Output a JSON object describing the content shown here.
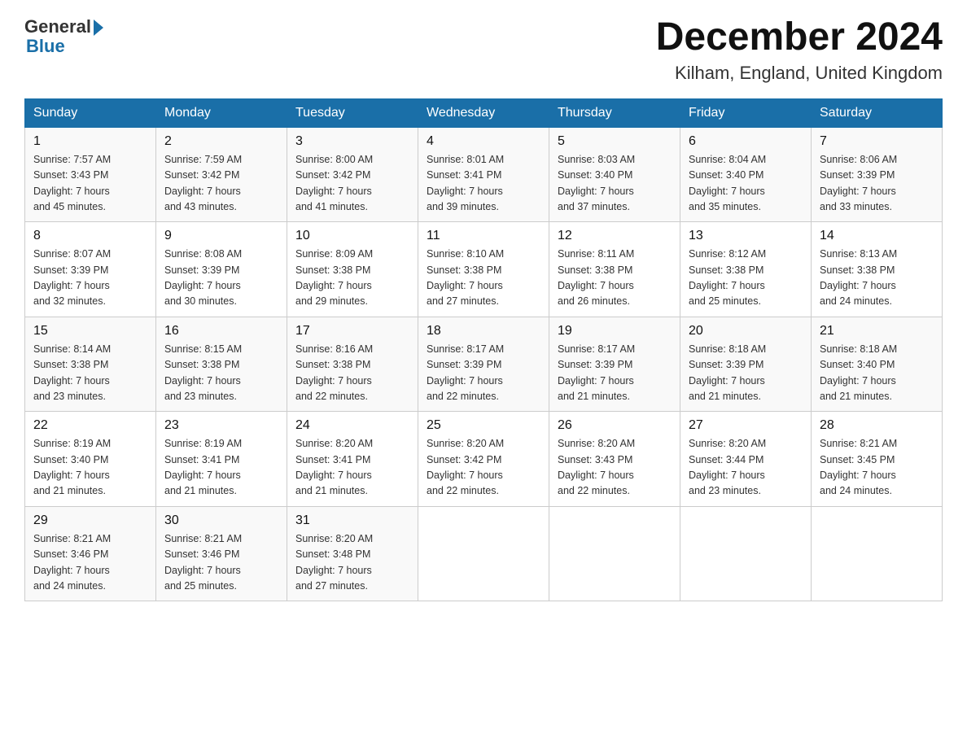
{
  "logo": {
    "general": "General",
    "blue": "Blue"
  },
  "title": "December 2024",
  "subtitle": "Kilham, England, United Kingdom",
  "headers": [
    "Sunday",
    "Monday",
    "Tuesday",
    "Wednesday",
    "Thursday",
    "Friday",
    "Saturday"
  ],
  "weeks": [
    [
      {
        "day": "1",
        "info": "Sunrise: 7:57 AM\nSunset: 3:43 PM\nDaylight: 7 hours\nand 45 minutes."
      },
      {
        "day": "2",
        "info": "Sunrise: 7:59 AM\nSunset: 3:42 PM\nDaylight: 7 hours\nand 43 minutes."
      },
      {
        "day": "3",
        "info": "Sunrise: 8:00 AM\nSunset: 3:42 PM\nDaylight: 7 hours\nand 41 minutes."
      },
      {
        "day": "4",
        "info": "Sunrise: 8:01 AM\nSunset: 3:41 PM\nDaylight: 7 hours\nand 39 minutes."
      },
      {
        "day": "5",
        "info": "Sunrise: 8:03 AM\nSunset: 3:40 PM\nDaylight: 7 hours\nand 37 minutes."
      },
      {
        "day": "6",
        "info": "Sunrise: 8:04 AM\nSunset: 3:40 PM\nDaylight: 7 hours\nand 35 minutes."
      },
      {
        "day": "7",
        "info": "Sunrise: 8:06 AM\nSunset: 3:39 PM\nDaylight: 7 hours\nand 33 minutes."
      }
    ],
    [
      {
        "day": "8",
        "info": "Sunrise: 8:07 AM\nSunset: 3:39 PM\nDaylight: 7 hours\nand 32 minutes."
      },
      {
        "day": "9",
        "info": "Sunrise: 8:08 AM\nSunset: 3:39 PM\nDaylight: 7 hours\nand 30 minutes."
      },
      {
        "day": "10",
        "info": "Sunrise: 8:09 AM\nSunset: 3:38 PM\nDaylight: 7 hours\nand 29 minutes."
      },
      {
        "day": "11",
        "info": "Sunrise: 8:10 AM\nSunset: 3:38 PM\nDaylight: 7 hours\nand 27 minutes."
      },
      {
        "day": "12",
        "info": "Sunrise: 8:11 AM\nSunset: 3:38 PM\nDaylight: 7 hours\nand 26 minutes."
      },
      {
        "day": "13",
        "info": "Sunrise: 8:12 AM\nSunset: 3:38 PM\nDaylight: 7 hours\nand 25 minutes."
      },
      {
        "day": "14",
        "info": "Sunrise: 8:13 AM\nSunset: 3:38 PM\nDaylight: 7 hours\nand 24 minutes."
      }
    ],
    [
      {
        "day": "15",
        "info": "Sunrise: 8:14 AM\nSunset: 3:38 PM\nDaylight: 7 hours\nand 23 minutes."
      },
      {
        "day": "16",
        "info": "Sunrise: 8:15 AM\nSunset: 3:38 PM\nDaylight: 7 hours\nand 23 minutes."
      },
      {
        "day": "17",
        "info": "Sunrise: 8:16 AM\nSunset: 3:38 PM\nDaylight: 7 hours\nand 22 minutes."
      },
      {
        "day": "18",
        "info": "Sunrise: 8:17 AM\nSunset: 3:39 PM\nDaylight: 7 hours\nand 22 minutes."
      },
      {
        "day": "19",
        "info": "Sunrise: 8:17 AM\nSunset: 3:39 PM\nDaylight: 7 hours\nand 21 minutes."
      },
      {
        "day": "20",
        "info": "Sunrise: 8:18 AM\nSunset: 3:39 PM\nDaylight: 7 hours\nand 21 minutes."
      },
      {
        "day": "21",
        "info": "Sunrise: 8:18 AM\nSunset: 3:40 PM\nDaylight: 7 hours\nand 21 minutes."
      }
    ],
    [
      {
        "day": "22",
        "info": "Sunrise: 8:19 AM\nSunset: 3:40 PM\nDaylight: 7 hours\nand 21 minutes."
      },
      {
        "day": "23",
        "info": "Sunrise: 8:19 AM\nSunset: 3:41 PM\nDaylight: 7 hours\nand 21 minutes."
      },
      {
        "day": "24",
        "info": "Sunrise: 8:20 AM\nSunset: 3:41 PM\nDaylight: 7 hours\nand 21 minutes."
      },
      {
        "day": "25",
        "info": "Sunrise: 8:20 AM\nSunset: 3:42 PM\nDaylight: 7 hours\nand 22 minutes."
      },
      {
        "day": "26",
        "info": "Sunrise: 8:20 AM\nSunset: 3:43 PM\nDaylight: 7 hours\nand 22 minutes."
      },
      {
        "day": "27",
        "info": "Sunrise: 8:20 AM\nSunset: 3:44 PM\nDaylight: 7 hours\nand 23 minutes."
      },
      {
        "day": "28",
        "info": "Sunrise: 8:21 AM\nSunset: 3:45 PM\nDaylight: 7 hours\nand 24 minutes."
      }
    ],
    [
      {
        "day": "29",
        "info": "Sunrise: 8:21 AM\nSunset: 3:46 PM\nDaylight: 7 hours\nand 24 minutes."
      },
      {
        "day": "30",
        "info": "Sunrise: 8:21 AM\nSunset: 3:46 PM\nDaylight: 7 hours\nand 25 minutes."
      },
      {
        "day": "31",
        "info": "Sunrise: 8:20 AM\nSunset: 3:48 PM\nDaylight: 7 hours\nand 27 minutes."
      },
      {
        "day": "",
        "info": ""
      },
      {
        "day": "",
        "info": ""
      },
      {
        "day": "",
        "info": ""
      },
      {
        "day": "",
        "info": ""
      }
    ]
  ]
}
